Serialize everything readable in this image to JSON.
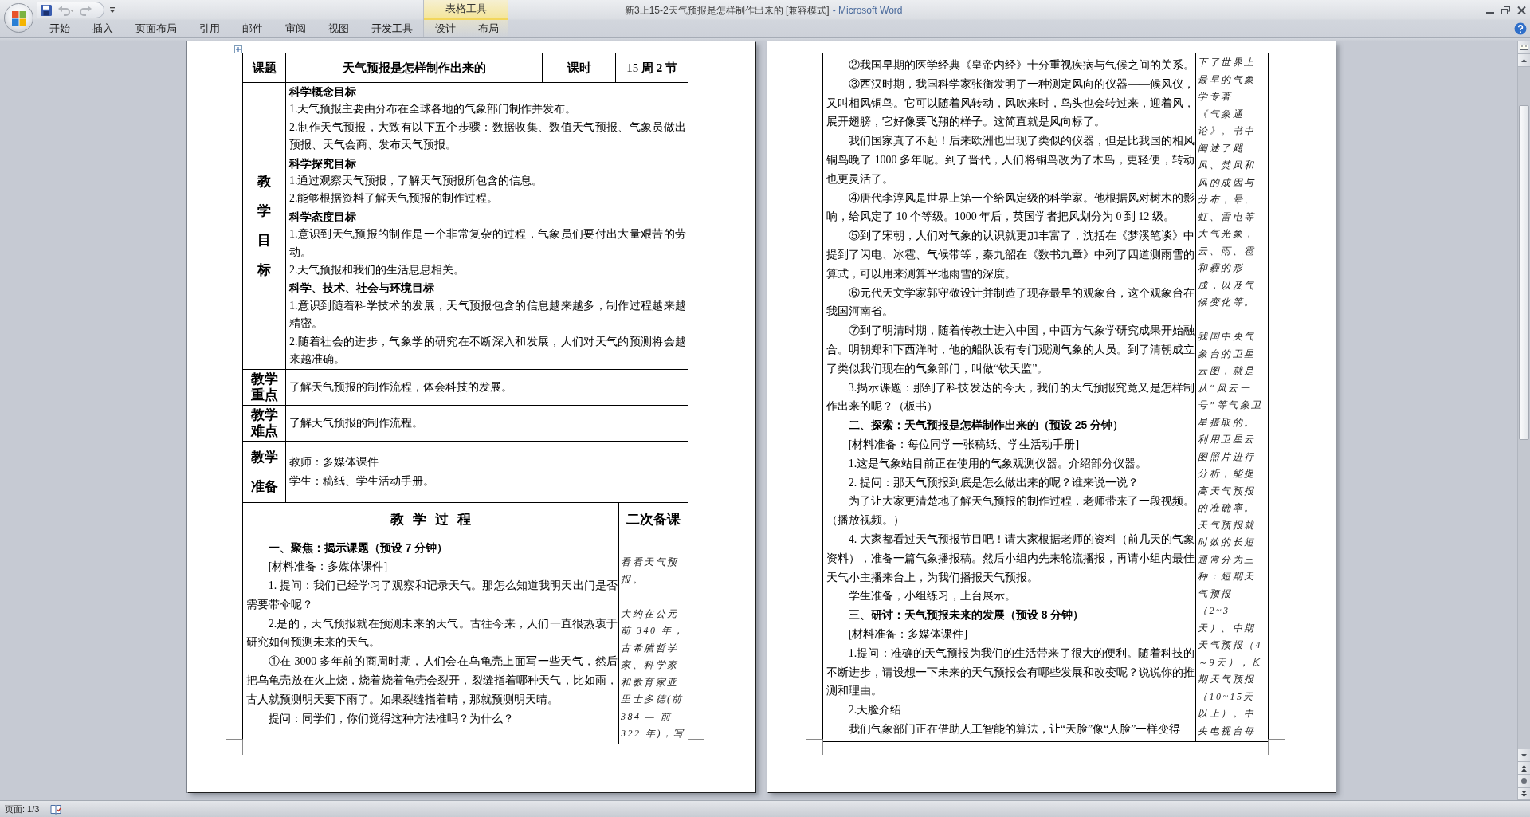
{
  "window": {
    "title": "新3上15-2天气预报是怎样制作出来的 [兼容模式]",
    "app_name": "- Microsoft Word"
  },
  "quick_access": [
    {
      "kind": "save",
      "disabled": false
    },
    {
      "kind": "undo",
      "disabled": true
    },
    {
      "kind": "redo",
      "disabled": true
    },
    {
      "kind": "customize",
      "disabled": false
    }
  ],
  "ribbon_tabs": [
    {
      "label": "开始",
      "selected": false
    },
    {
      "label": "插入",
      "selected": false
    },
    {
      "label": "页面布局",
      "selected": false
    },
    {
      "label": "引用",
      "selected": false
    },
    {
      "label": "邮件",
      "selected": false
    },
    {
      "label": "审阅",
      "selected": false
    },
    {
      "label": "视图",
      "selected": false
    },
    {
      "label": "开发工具",
      "selected": false
    }
  ],
  "contextual_tabs": {
    "group_label": "表格工具",
    "tabs": [
      {
        "label": "设计",
        "selected": false
      },
      {
        "label": "布局",
        "selected": false
      }
    ]
  },
  "pages": [
    {
      "kind": "lesson_plan",
      "topic_label": "课题",
      "topic": "天气预报是怎样制作出来的",
      "period_label": "课时",
      "period": "15 **周 2 节**",
      "rows": [
        {
          "kind": "goals",
          "header": "教学目标",
          "paragraphs": [
            {
              "kind": "heading",
              "text": "科学概念目标"
            },
            {
              "kind": "item",
              "text": "1.天气预报主要由分布在全球各地的气象部门制作并发布。"
            },
            {
              "kind": "item",
              "text": "2.制作天气预报，大致有以下五个步骤：数据收集、数值天气预报、气象员做出预报、天气会商、发布天气预报。"
            },
            {
              "kind": "heading",
              "text": "科学探究目标"
            },
            {
              "kind": "item",
              "text": "1.通过观察天气预报，了解天气预报所包含的信息。"
            },
            {
              "kind": "item",
              "text": "2.能够根据资料了解天气预报的制作过程。"
            },
            {
              "kind": "heading",
              "text": "科学态度目标"
            },
            {
              "kind": "item",
              "text": "1.意识到天气预报的制作是一个非常复杂的过程，气象员们要付出大量艰苦的劳动。"
            },
            {
              "kind": "item",
              "text": "2.天气预报和我们的生活息息相关。"
            },
            {
              "kind": "heading",
              "text": "科学、技术、社会与环境目标"
            },
            {
              "kind": "item",
              "text": "1.意识到随着科学技术的发展，天气预报包含的信息越来越多，制作过程越来越精密。"
            },
            {
              "kind": "item",
              "text": "2.随着社会的进步，气象学的研究在不断深入和发展，人们对天气的预测将会越来越准确。"
            }
          ]
        },
        {
          "kind": "brief",
          "header": "教学重点",
          "paragraphs": [
            {
              "kind": "item",
              "text": "了解天气预报的制作流程，体会科技的发展。"
            }
          ]
        },
        {
          "kind": "brief",
          "header": "教学难点",
          "paragraphs": [
            {
              "kind": "item",
              "text": "了解天气预报的制作流程。"
            }
          ]
        },
        {
          "kind": "prep",
          "header": "教学准备",
          "paragraphs": [
            {
              "kind": "item",
              "text": "教师：多媒体课件"
            },
            {
              "kind": "item",
              "text": "学生：稿纸、学生活动手册。"
            }
          ]
        }
      ],
      "process_header": "教 学 过 程",
      "notes_header": "二次备课",
      "process": [
        {
          "kind": "section",
          "text": "一、聚焦：揭示课题（预设 7 分钟）"
        },
        {
          "kind": "para",
          "text": "[材料准备：多媒体课件]"
        },
        {
          "kind": "para",
          "text": "1. 提问：我们已经学习了观察和记录天气。那怎么知道我明天出门是否需要带伞呢？"
        },
        {
          "kind": "para",
          "text": "2.是的，天气预报就在预测未来的天气。古往今来，人们一直很热衷于研究如何预测未来的天气。"
        },
        {
          "kind": "para",
          "text": "①在 3000 多年前的商周时期，人们会在乌龟壳上面写一些天气，然后把乌龟壳放在火上烧，烧着烧着龟壳会裂开，裂缝指着哪种天气，比如雨，古人就预测明天要下雨了。如果裂缝指着晴，那就预测明天晴。"
        },
        {
          "kind": "para",
          "text": "提问：同学们，你们觉得这种方法准吗？为什么？"
        }
      ],
      "notes": [
        {
          "text": "看看天气预报。"
        },
        {
          "text": "大约在公元前 340 年，古希腊哲学家、科学家和教育家亚里士多德(前 384 — 前 322 年)，写"
        }
      ]
    },
    {
      "kind": "continuation",
      "process": [
        {
          "kind": "para",
          "text": "②我国早期的医学经典《皇帝内经》十分重视疾病与气候之间的关系。"
        },
        {
          "kind": "para",
          "text": "③西汉时期，我国科学家张衡发明了一种测定风向的仪器——候风仪，又叫相风铜鸟。它可以随着风转动，风吹来时，鸟头也会转过来，迎着风，展开翅膀，它好像要飞翔的样子。这简直就是风向标了。"
        },
        {
          "kind": "para",
          "text": "我们国家真了不起！后来欧洲也出现了类似的仪器，但是比我国的相风铜鸟晚了 1000 多年呢。到了晋代，人们将铜鸟改为了木鸟，更轻便，转动也更灵活了。"
        },
        {
          "kind": "para",
          "text": "④唐代李淳风是世界上第一个给风定级的科学家。他根据风对树木的影响，给风定了 10 个等级。1000 年后，英国学者把风划分为 0 到 12 级。"
        },
        {
          "kind": "para",
          "text": "⑤到了宋朝，人们对气象的认识就更加丰富了，沈括在《梦溪笔谈》中提到了闪电、冰雹、气候带等，秦九韶在《数书九章》中列了四道测雨雪的算式，可以用来测算平地雨雪的深度。"
        },
        {
          "kind": "para",
          "text": "⑥元代天文学家郭守敬设计并制造了现存最早的观象台，这个观象台在我国河南省。"
        },
        {
          "kind": "para",
          "text": "⑦到了明清时期，随着传教士进入中国，中西方气象学研究成果开始融合。明朝郑和下西洋时，他的船队设有专门观测气象的人员。到了清朝成立了类似我们现在的气象部门，叫做“钦天监”。"
        },
        {
          "kind": "para",
          "text": "3.揭示课题：那到了科技发达的今天，我们的天气预报究竟又是怎样制作出来的呢？（板书）"
        },
        {
          "kind": "section",
          "text": "二、探索：天气预报是怎样制作出来的（预设 25 分钟）"
        },
        {
          "kind": "para",
          "text": "[材料准备：每位同学一张稿纸、学生活动手册]"
        },
        {
          "kind": "para",
          "text": "1.这是气象站目前正在使用的气象观测仪器。介绍部分仪器。"
        },
        {
          "kind": "para",
          "text": "2. 提问：那天气预报到底是怎么做出来的呢？谁来说一说？"
        },
        {
          "kind": "para",
          "text": "为了让大家更清楚地了解天气预报的制作过程，老师带来了一段视频。（播放视频。）"
        },
        {
          "kind": "para",
          "text": "4. 大家都看过天气预报节目吧！请大家根据老师的资料（前几天的气象资料），准备一篇气象播报稿。然后小组内先来轮流播报，再请小组内最佳天气小主播来台上，为我们播报天气预报。"
        },
        {
          "kind": "para",
          "text": "学生准备，小组练习，上台展示。"
        },
        {
          "kind": "section",
          "text": "三、研讨：天气预报未来的发展（预设 8 分钟）"
        },
        {
          "kind": "para",
          "text": "[材料准备：多媒体课件]"
        },
        {
          "kind": "para",
          "text": "1.提问：准确的天气预报为我们的生活带来了很大的便利。随着科技的不断进步，请设想一下未来的天气预报会有哪些发展和改变呢？说说你的推测和理由。"
        },
        {
          "kind": "para",
          "text": "2.天脸介绍"
        },
        {
          "kind": "para",
          "text": "我们气象部门正在借助人工智能的算法，让“天脸”像“人脸”一样变得"
        }
      ],
      "notes": [
        {
          "text": "下了世界上最早的气象学专著一《气象通论》。书中阐述了飓风、焚风和风的成因与分布，晕、虹、雷电等大气光象，云、雨、雹和霾的形成，以及气候变化等。"
        },
        {
          "text": "我国中央气象台的卫星云图，就是从“风云一号”等气象卫星摄取的。利用卫星云图照片进行分析，能提高天气预报的准确率。天气预报就时效的长短通常分为三种：短期天气预报（2~3天）、中期天气预报（4～9天），长期天气预报（10~15天以上）。中央电视台每"
        }
      ]
    }
  ],
  "status_bar": {
    "page": "页面: 1/3"
  }
}
